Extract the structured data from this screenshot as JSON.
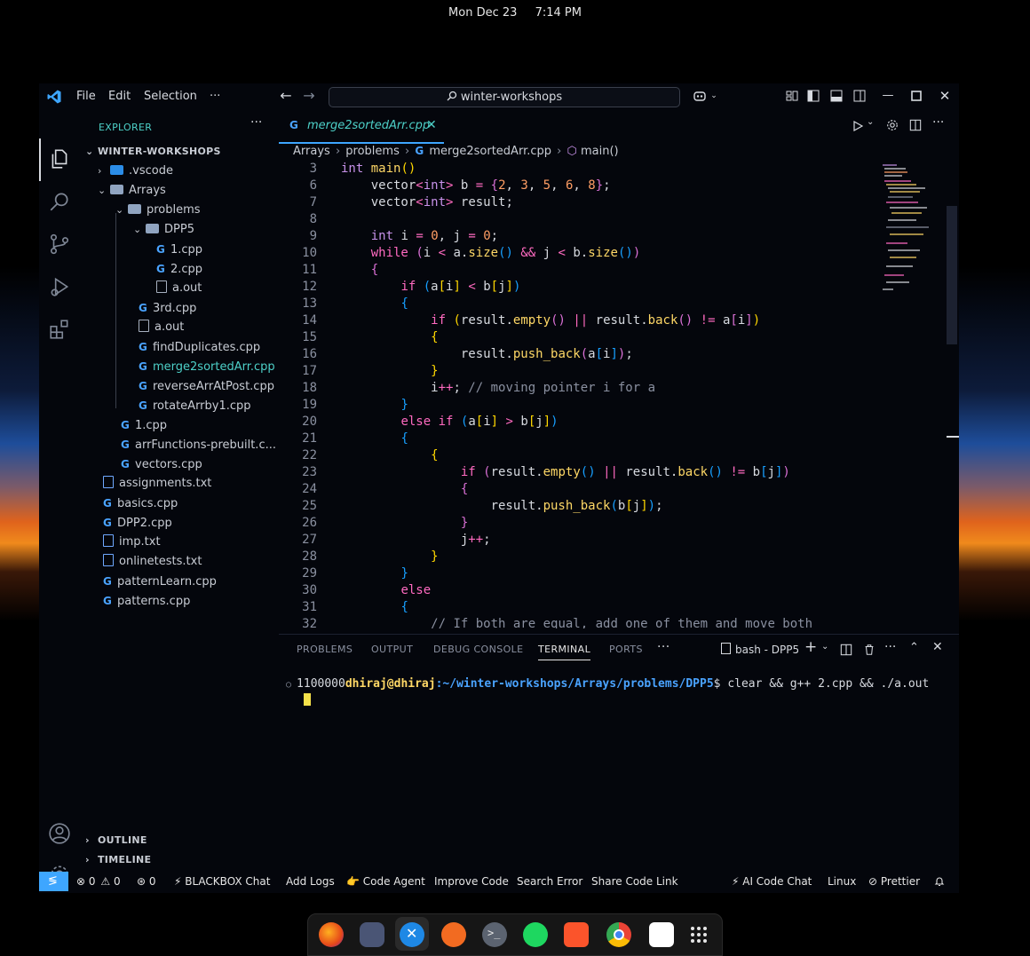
{
  "topbar": {
    "date": "Mon Dec 23",
    "time": "7:14 PM"
  },
  "menu": {
    "file": "File",
    "edit": "Edit",
    "selection": "Selection",
    "more": "···"
  },
  "search": {
    "text": "winter-workshops"
  },
  "explorer": {
    "title": "EXPLORER",
    "root": "WINTER-WORKSHOPS",
    "items": [
      {
        "label": ".vscode",
        "kind": "vscode-folder",
        "chev": "›",
        "indent": 1
      },
      {
        "label": "Arrays",
        "kind": "folder",
        "chev": "⌄",
        "indent": 1
      },
      {
        "label": "problems",
        "kind": "folder",
        "chev": "⌄",
        "indent": 2
      },
      {
        "label": "DPP5",
        "kind": "folder",
        "chev": "⌄",
        "indent": 3
      },
      {
        "label": "1.cpp",
        "kind": "cpp",
        "indent": 4
      },
      {
        "label": "2.cpp",
        "kind": "cpp",
        "indent": 4
      },
      {
        "label": "a.out",
        "kind": "file",
        "indent": 4
      },
      {
        "label": "3rd.cpp",
        "kind": "cpp",
        "indent": 3
      },
      {
        "label": "a.out",
        "kind": "file",
        "indent": 3
      },
      {
        "label": "findDuplicates.cpp",
        "kind": "cpp",
        "indent": 3
      },
      {
        "label": "merge2sortedArr.cpp",
        "kind": "cpp",
        "indent": 3,
        "active": true
      },
      {
        "label": "reverseArrAtPost.cpp",
        "kind": "cpp",
        "indent": 3
      },
      {
        "label": "rotateArrby1.cpp",
        "kind": "cpp",
        "indent": 3
      },
      {
        "label": "1.cpp",
        "kind": "cpp",
        "indent": 2
      },
      {
        "label": "arrFunctions-prebuilt.c...",
        "kind": "cpp",
        "indent": 2
      },
      {
        "label": "vectors.cpp",
        "kind": "cpp",
        "indent": 2
      },
      {
        "label": "assignments.txt",
        "kind": "txt",
        "indent": 1
      },
      {
        "label": "basics.cpp",
        "kind": "cpp",
        "indent": 1
      },
      {
        "label": "DPP2.cpp",
        "kind": "cpp",
        "indent": 1
      },
      {
        "label": "imp.txt",
        "kind": "txt",
        "indent": 1
      },
      {
        "label": "onlinetests.txt",
        "kind": "txt",
        "indent": 1
      },
      {
        "label": "patternLearn.cpp",
        "kind": "cpp",
        "indent": 1
      },
      {
        "label": "patterns.cpp",
        "kind": "cpp",
        "indent": 1
      }
    ],
    "outline": "OUTLINE",
    "timeline": "TIMELINE"
  },
  "editor": {
    "tab_label": "merge2sortedArr.cpp",
    "breadcrumb": [
      "Arrays",
      "problems",
      "merge2sortedArr.cpp",
      "main()"
    ],
    "lines": [
      {
        "n": "3",
        "html": "<span class='ty'>int</span> <span class='fn'>main</span><span class='br1'>()</span>"
      },
      {
        "n": "6",
        "html": "    <span class='var'>vector</span><span class='op'>&lt;</span><span class='ty'>int</span><span class='op'>&gt;</span> b <span class='op'>=</span> <span class='br2'>{</span><span class='nm'>2</span>, <span class='nm'>3</span>, <span class='nm'>5</span>, <span class='nm'>6</span>, <span class='nm'>8</span><span class='br2'>}</span>;"
      },
      {
        "n": "7",
        "html": "    <span class='var'>vector</span><span class='op'>&lt;</span><span class='ty'>int</span><span class='op'>&gt;</span> result;"
      },
      {
        "n": "8",
        "html": ""
      },
      {
        "n": "9",
        "html": "    <span class='ty'>int</span> i <span class='op'>=</span> <span class='nm'>0</span>, j <span class='op'>=</span> <span class='nm'>0</span>;"
      },
      {
        "n": "10",
        "html": "    <span class='kw'>while</span> <span class='br2'>(</span>i <span class='op'>&lt;</span> a.<span class='fn'>size</span><span class='br3'>()</span> <span class='op'>&amp;&amp;</span> j <span class='op'>&lt;</span> b.<span class='fn'>size</span><span class='br3'>()</span><span class='br2'>)</span>"
      },
      {
        "n": "11",
        "html": "    <span class='br2'>{</span>"
      },
      {
        "n": "12",
        "html": "        <span class='kw'>if</span> <span class='br3'>(</span>a<span class='br1'>[</span>i<span class='br1'>]</span> <span class='op'>&lt;</span> b<span class='br1'>[</span>j<span class='br1'>]</span><span class='br3'>)</span>"
      },
      {
        "n": "13",
        "html": "        <span class='br3'>{</span>"
      },
      {
        "n": "14",
        "html": "            <span class='kw'>if</span> <span class='br1'>(</span>result.<span class='fn'>empty</span><span class='br2'>()</span> <span class='op'>||</span> result.<span class='fn'>back</span><span class='br2'>()</span> <span class='op'>!=</span> a<span class='br2'>[</span>i<span class='br2'>]</span><span class='br1'>)</span>"
      },
      {
        "n": "15",
        "html": "            <span class='br1'>{</span>"
      },
      {
        "n": "16",
        "html": "                result.<span class='fn'>push_back</span><span class='br2'>(</span>a<span class='br3'>[</span>i<span class='br3'>]</span><span class='br2'>)</span>;"
      },
      {
        "n": "17",
        "html": "            <span class='br1'>}</span>"
      },
      {
        "n": "18",
        "html": "            i<span class='op'>++</span>; <span class='cm'>// moving pointer i for a</span>"
      },
      {
        "n": "19",
        "html": "        <span class='br3'>}</span>"
      },
      {
        "n": "20",
        "html": "        <span class='kw'>else</span> <span class='kw'>if</span> <span class='br3'>(</span>a<span class='br1'>[</span>i<span class='br1'>]</span> <span class='op'>&gt;</span> b<span class='br1'>[</span>j<span class='br1'>]</span><span class='br3'>)</span>"
      },
      {
        "n": "21",
        "html": "        <span class='br3'>{</span>"
      },
      {
        "n": "22",
        "html": "            <span class='br1'>{</span>"
      },
      {
        "n": "23",
        "html": "                <span class='kw'>if</span> <span class='br2'>(</span>result.<span class='fn'>empty</span><span class='br3'>()</span> <span class='op'>||</span> result.<span class='fn'>back</span><span class='br3'>()</span> <span class='op'>!=</span> b<span class='br3'>[</span>j<span class='br3'>]</span><span class='br2'>)</span>"
      },
      {
        "n": "24",
        "html": "                <span class='br2'>{</span>"
      },
      {
        "n": "25",
        "html": "                    result.<span class='fn'>push_back</span><span class='br3'>(</span>b<span class='br1'>[</span>j<span class='br1'>]</span><span class='br3'>)</span>;"
      },
      {
        "n": "26",
        "html": "                <span class='br2'>}</span>"
      },
      {
        "n": "27",
        "html": "                j<span class='op'>++</span>;"
      },
      {
        "n": "28",
        "html": "            <span class='br1'>}</span>"
      },
      {
        "n": "29",
        "html": "        <span class='br3'>}</span>"
      },
      {
        "n": "30",
        "html": "        <span class='kw'>else</span>"
      },
      {
        "n": "31",
        "html": "        <span class='br3'>{</span>"
      },
      {
        "n": "32",
        "html": "            <span class='cm'>// If both are equal, add one of them and move both</span>"
      }
    ]
  },
  "panel": {
    "tabs": [
      "PROBLEMS",
      "OUTPUT",
      "DEBUG CONSOLE",
      "TERMINAL",
      "PORTS",
      "···"
    ],
    "active_tab": "TERMINAL",
    "shell": "bash - DPP5",
    "prompt_num": "1100000",
    "prompt_user": "dhiraj@dhiraj",
    "prompt_path": ":~/winter-workshops/Arrays/problems/DPP5",
    "prompt_cmd": "$ clear && g++ 2.cpp && ./a.out"
  },
  "status": {
    "errors": "0",
    "warnings": "0",
    "ports": "0",
    "left_items": [
      "⚡ BLACKBOX Chat",
      "Add Logs",
      "👉 Code Agent",
      "Improve Code",
      "Search Error",
      "Share Code Link"
    ],
    "right_items": [
      "⚡ AI Code Chat",
      "Linux",
      "Prettier"
    ]
  },
  "colors": {
    "accent": "#3ea6ff",
    "active_text": "#4dd0c8",
    "cursor": "#f5e14a"
  }
}
